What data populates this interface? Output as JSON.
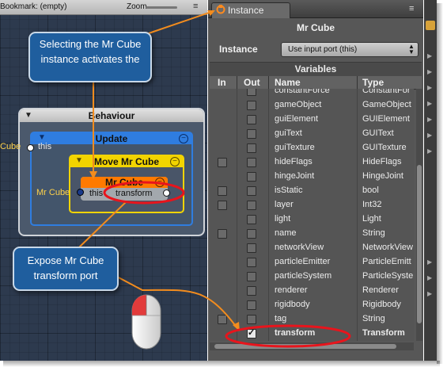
{
  "graph_canvas": {
    "toolbar": {
      "bookmark_label": "Bookmark: (empty)",
      "zoom_label": "Zoom"
    },
    "behaviour_node": {
      "title": "Behaviour"
    },
    "update_node": {
      "title": "Update"
    },
    "move_node": {
      "title": "Move Mr Cube"
    },
    "mrcube_node": {
      "title": "Mr Cube",
      "port_this": "this",
      "port_transform": "transform"
    },
    "inputs": {
      "cube_partial": "Cube",
      "this_label": "this",
      "mrcube_label": "Mr Cube"
    }
  },
  "callouts": {
    "top": [
      "Selecting the Mr Cube",
      "instance activates the"
    ],
    "bottom": [
      "Expose Mr Cube",
      "transform port"
    ]
  },
  "instance_panel": {
    "tab_label": "Instance",
    "object_title": "Mr Cube",
    "instance_label": "Instance",
    "instance_select_value": "Use input port (this)",
    "variables_header": "Variables",
    "columns": {
      "in": "In",
      "out": "Out",
      "name": "Name",
      "type": "Type"
    },
    "rows": [
      {
        "name": "constantForce",
        "type": "ConstantFor",
        "in_cb": false,
        "out_cb": true,
        "checked": false
      },
      {
        "name": "gameObject",
        "type": "GameObject",
        "in_cb": false,
        "out_cb": true,
        "checked": false
      },
      {
        "name": "guiElement",
        "type": "GUIElement",
        "in_cb": false,
        "out_cb": true,
        "checked": false
      },
      {
        "name": "guiText",
        "type": "GUIText",
        "in_cb": false,
        "out_cb": true,
        "checked": false
      },
      {
        "name": "guiTexture",
        "type": "GUITexture",
        "in_cb": false,
        "out_cb": true,
        "checked": false
      },
      {
        "name": "hideFlags",
        "type": "HideFlags",
        "in_cb": true,
        "out_cb": true,
        "checked": false
      },
      {
        "name": "hingeJoint",
        "type": "HingeJoint",
        "in_cb": false,
        "out_cb": true,
        "checked": false
      },
      {
        "name": "isStatic",
        "type": "bool",
        "in_cb": true,
        "out_cb": true,
        "checked": false
      },
      {
        "name": "layer",
        "type": "Int32",
        "in_cb": true,
        "out_cb": true,
        "checked": false
      },
      {
        "name": "light",
        "type": "Light",
        "in_cb": false,
        "out_cb": true,
        "checked": false
      },
      {
        "name": "name",
        "type": "String",
        "in_cb": true,
        "out_cb": true,
        "checked": false
      },
      {
        "name": "networkView",
        "type": "NetworkView",
        "in_cb": false,
        "out_cb": true,
        "checked": false
      },
      {
        "name": "particleEmitter",
        "type": "ParticleEmitt",
        "in_cb": false,
        "out_cb": true,
        "checked": false
      },
      {
        "name": "particleSystem",
        "type": "ParticleSyste",
        "in_cb": false,
        "out_cb": true,
        "checked": false
      },
      {
        "name": "renderer",
        "type": "Renderer",
        "in_cb": false,
        "out_cb": true,
        "checked": false
      },
      {
        "name": "rigidbody",
        "type": "Rigidbody",
        "in_cb": false,
        "out_cb": true,
        "checked": false
      },
      {
        "name": "tag",
        "type": "String",
        "in_cb": true,
        "out_cb": true,
        "checked": false
      },
      {
        "name": "transform",
        "type": "Transform",
        "in_cb": false,
        "out_cb": true,
        "checked": true
      }
    ],
    "checkmark_glyph": "✓"
  },
  "icons": {
    "menu": "≡",
    "triangle": "▼",
    "minus": "−",
    "select_arrows": "▲▼",
    "sliver_arrow": "▶"
  },
  "colors": {
    "callout_fill": "#1f5e9e",
    "annotation_orange": "#f28c1e",
    "highlight_ring": "#e8141c",
    "update_blue": "#2f7de0",
    "move_yellow": "#f2d400",
    "mrcube_orange": "#ff7a00"
  }
}
